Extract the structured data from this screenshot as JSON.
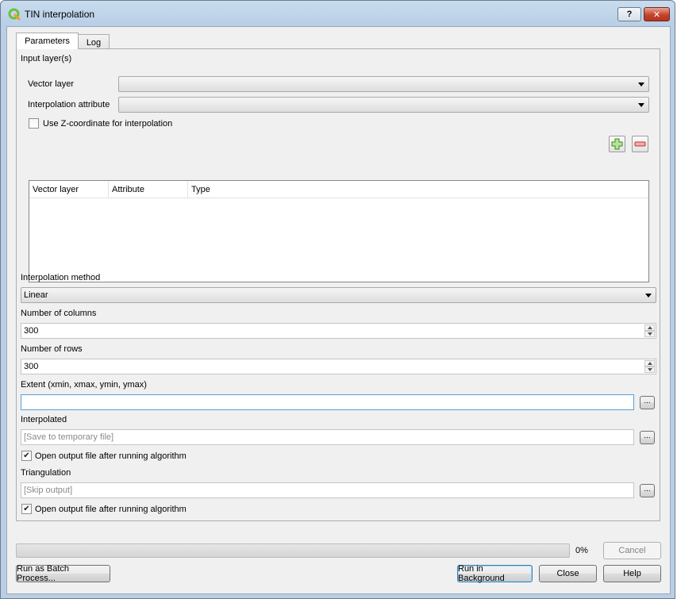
{
  "window": {
    "title": "TIN interpolation",
    "help_label": "?",
    "close_label": "✕"
  },
  "tabs": [
    {
      "label": "Parameters",
      "active": true
    },
    {
      "label": "Log",
      "active": false
    }
  ],
  "input_layers": {
    "section_label": "Input layer(s)",
    "vector_layer_label": "Vector layer",
    "vector_layer_value": "",
    "interp_attr_label": "Interpolation attribute",
    "interp_attr_value": "",
    "use_z_label": "Use Z-coordinate for interpolation",
    "use_z_checked": false,
    "add_icon": "plus-icon",
    "remove_icon": "minus-icon",
    "table_columns": [
      "Vector layer",
      "Attribute",
      "Type"
    ],
    "table_rows": []
  },
  "interpolation_method": {
    "label": "Interpolation method",
    "value": "Linear"
  },
  "columns": {
    "label": "Number of columns",
    "value": "300"
  },
  "rows": {
    "label": "Number of rows",
    "value": "300"
  },
  "extent": {
    "label": "Extent (xmin, xmax, ymin, ymax)",
    "value": "",
    "browse_label": "..."
  },
  "interpolated": {
    "label": "Interpolated",
    "placeholder": "[Save to temporary file]",
    "browse_label": "...",
    "open_label": "Open output file after running algorithm",
    "open_checked": true
  },
  "triangulation": {
    "label": "Triangulation",
    "placeholder": "[Skip output]",
    "browse_label": "...",
    "open_label": "Open output file after running algorithm",
    "open_checked": true
  },
  "progress": {
    "value": 0,
    "text": "0%"
  },
  "buttons": {
    "cancel": "Cancel",
    "batch": "Run as Batch Process...",
    "run_background": "Run in Background",
    "close": "Close",
    "help": "Help"
  },
  "colors": {
    "accent_green": "#6bbf3f",
    "remove_red": "#d9534f",
    "focus_blue": "#5a9fd4"
  }
}
